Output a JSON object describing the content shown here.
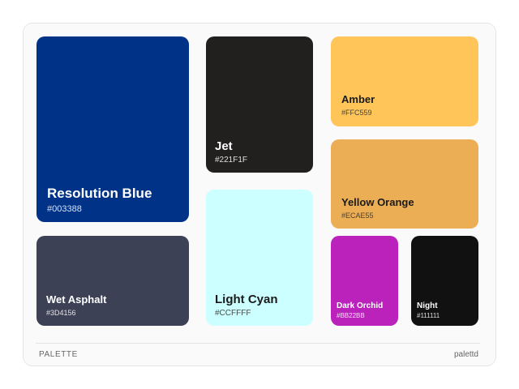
{
  "swatches": [
    {
      "key": "resolution_blue",
      "name": "Resolution Blue",
      "hex": "#003388",
      "color": "#003388"
    },
    {
      "key": "jet",
      "name": "Jet",
      "hex": "#221F1F",
      "color": "#221F1F"
    },
    {
      "key": "amber",
      "name": "Amber",
      "hex": "#FFC559",
      "color": "#FFC559"
    },
    {
      "key": "yellow_orange",
      "name": "Yellow Orange",
      "hex": "#ECAE55",
      "color": "#ECAE55"
    },
    {
      "key": "light_cyan",
      "name": "Light Cyan",
      "hex": "#CCFFFF",
      "color": "#CCFFFF"
    },
    {
      "key": "wet_asphalt",
      "name": "Wet Asphalt",
      "hex": "#3D4156",
      "color": "#3D4156"
    },
    {
      "key": "dark_orchid",
      "name": "Dark Orchid",
      "hex": "#BB22BB",
      "color": "#BB22BB"
    },
    {
      "key": "night",
      "name": "Night",
      "hex": "#111111",
      "color": "#111111"
    }
  ],
  "footer": {
    "label": "PALETTE",
    "brand": "palettd"
  }
}
